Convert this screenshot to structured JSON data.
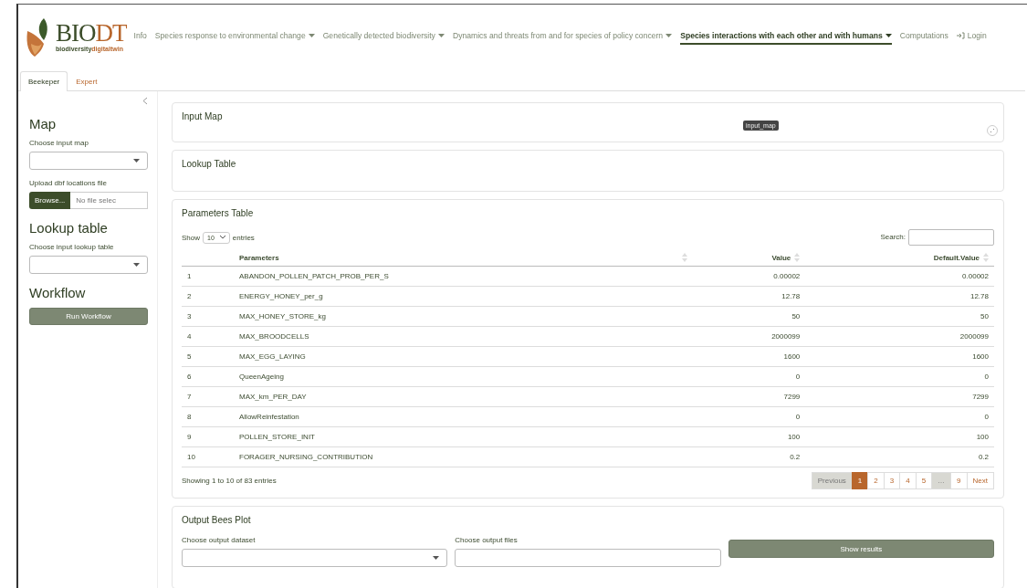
{
  "logo": {
    "main": "BIO",
    "accent": "DT",
    "sub": "biodiversity",
    "sub_accent": "digitaltwin"
  },
  "nav": [
    {
      "label": "Info",
      "dropdown": false,
      "selected": false,
      "kind": "link"
    },
    {
      "label": "Species response to environmental change",
      "dropdown": true,
      "selected": false,
      "kind": "link"
    },
    {
      "label": "Genetically detected biodiversity",
      "dropdown": true,
      "selected": false,
      "kind": "link"
    },
    {
      "label": "Dynamics and threats from and for species of policy concern",
      "dropdown": true,
      "selected": false,
      "kind": "link"
    },
    {
      "label": "Species interactions with each other and with humans",
      "dropdown": true,
      "selected": true,
      "kind": "link"
    },
    {
      "label": "Computations",
      "dropdown": false,
      "selected": false,
      "kind": "link"
    },
    {
      "label": "Login",
      "dropdown": false,
      "selected": false,
      "kind": "login"
    }
  ],
  "tabs": [
    {
      "label": "Beekeper",
      "selected": true
    },
    {
      "label": "Expert",
      "selected": false
    }
  ],
  "sidebar": {
    "sections": [
      {
        "title": "Map",
        "controls": [
          {
            "kind": "select",
            "label": "Choose input map"
          },
          {
            "kind": "file",
            "label": "Upload dbf locations file",
            "button": "Browse...",
            "value": "No file selec"
          }
        ]
      },
      {
        "title": "Lookup table",
        "controls": [
          {
            "kind": "select",
            "label": "Choose input lookup table"
          }
        ]
      },
      {
        "title": "Workflow",
        "controls": [
          {
            "kind": "button",
            "label": "Run Workflow"
          }
        ]
      }
    ]
  },
  "input_map": {
    "title": "Input Map",
    "tooltip": "input_map"
  },
  "lookup_table": {
    "title": "Lookup Table"
  },
  "parameters_table": {
    "title": "Parameters Table",
    "show_label": "Show",
    "page_size": "10",
    "entries_label": "entries",
    "search_label": "Search:",
    "columns": [
      "",
      "Parameters",
      "Value",
      "Default.Value"
    ],
    "rows": [
      [
        "1",
        "ABANDON_POLLEN_PATCH_PROB_PER_S",
        "0.00002",
        "0.00002"
      ],
      [
        "2",
        "ENERGY_HONEY_per_g",
        "12.78",
        "12.78"
      ],
      [
        "3",
        "MAX_HONEY_STORE_kg",
        "50",
        "50"
      ],
      [
        "4",
        "MAX_BROODCELLS",
        "2000099",
        "2000099"
      ],
      [
        "5",
        "MAX_EGG_LAYING",
        "1600",
        "1600"
      ],
      [
        "6",
        "QueenAgeing",
        "0",
        "0"
      ],
      [
        "7",
        "MAX_km_PER_DAY",
        "7299",
        "7299"
      ],
      [
        "8",
        "AllowReinfestation",
        "0",
        "0"
      ],
      [
        "9",
        "POLLEN_STORE_INIT",
        "100",
        "100"
      ],
      [
        "10",
        "FORAGER_NURSING_CONTRIBUTION",
        "0.2",
        "0.2"
      ]
    ],
    "info": "Showing 1 to 10 of 83 entries",
    "pagination": [
      {
        "label": "Previous",
        "selected": false,
        "disabled": true
      },
      {
        "label": "1",
        "selected": true,
        "disabled": false
      },
      {
        "label": "2",
        "selected": false,
        "disabled": false
      },
      {
        "label": "3",
        "selected": false,
        "disabled": false
      },
      {
        "label": "4",
        "selected": false,
        "disabled": false
      },
      {
        "label": "5",
        "selected": false,
        "disabled": false
      },
      {
        "label": "…",
        "selected": false,
        "disabled": true
      },
      {
        "label": "9",
        "selected": false,
        "disabled": false
      },
      {
        "label": "Next",
        "selected": false,
        "disabled": false
      }
    ]
  },
  "output_plot": {
    "title": "Output Bees Plot",
    "dataset_label": "Choose output dataset",
    "files_label": "Choose output files",
    "button": "Show results"
  }
}
